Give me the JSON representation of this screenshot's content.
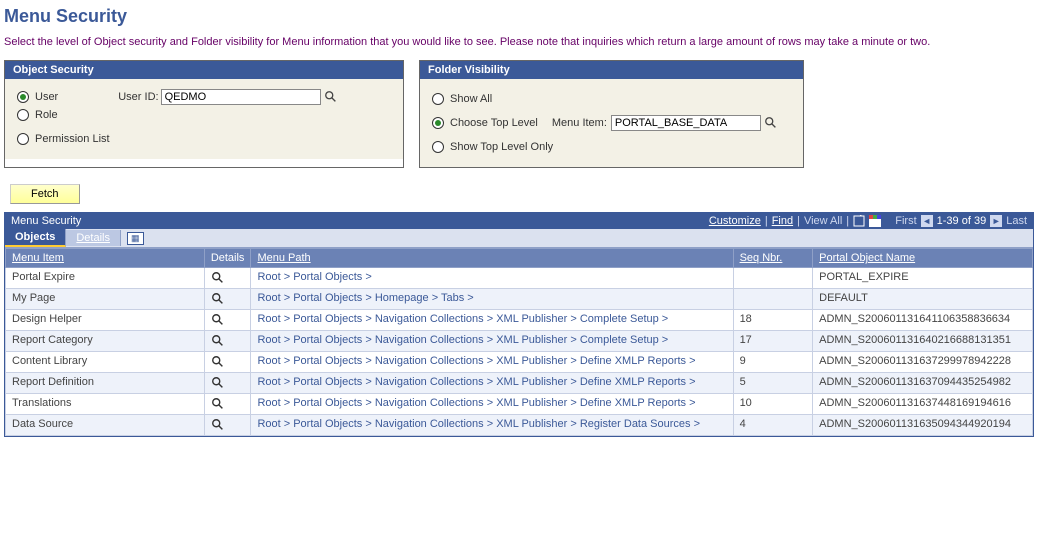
{
  "page": {
    "title": "Menu Security",
    "description": "Select the level of Object security and Folder visibility for Menu information that you would like to see. Please note that inquiries which return a large amount of rows may take a minute or two."
  },
  "object_security": {
    "header": "Object Security",
    "options": {
      "user": "User",
      "role": "Role",
      "perm": "Permission List"
    },
    "selected": "user",
    "user_id_label": "User ID:",
    "user_id_value": "QEDMO"
  },
  "folder_visibility": {
    "header": "Folder Visibility",
    "options": {
      "show_all": "Show All",
      "choose": "Choose Top Level",
      "top_only": "Show Top Level Only"
    },
    "selected": "choose",
    "menu_item_label": "Menu Item:",
    "menu_item_value": "PORTAL_BASE_DATA"
  },
  "fetch_label": "Fetch",
  "grid": {
    "title": "Menu Security",
    "toolbar": {
      "customize": "Customize",
      "find": "Find",
      "view_all": "View All",
      "first": "First",
      "range": "1-39 of 39",
      "last": "Last"
    },
    "tabs": {
      "objects": "Objects",
      "details": "Details"
    },
    "columns": {
      "menu_item": "Menu Item",
      "details": "Details",
      "menu_path": "Menu Path",
      "seq": "Seq Nbr.",
      "portal": "Portal Object Name"
    },
    "rows": [
      {
        "menu_item": "Portal Expire",
        "menu_path": "Root > Portal Objects >",
        "seq": "",
        "portal": "PORTAL_EXPIRE"
      },
      {
        "menu_item": "My Page",
        "menu_path": "Root > Portal Objects > Homepage > Tabs >",
        "seq": "",
        "portal": "DEFAULT"
      },
      {
        "menu_item": "Design Helper",
        "menu_path": "Root > Portal Objects > Navigation Collections > XML Publisher > Complete Setup >",
        "seq": "18",
        "portal": "ADMN_S200601131641106358836634"
      },
      {
        "menu_item": "Report Category",
        "menu_path": "Root > Portal Objects > Navigation Collections > XML Publisher > Complete Setup >",
        "seq": "17",
        "portal": "ADMN_S200601131640216688131351"
      },
      {
        "menu_item": "Content Library",
        "menu_path": "Root > Portal Objects > Navigation Collections > XML Publisher > Define XMLP Reports >",
        "seq": "9",
        "portal": "ADMN_S200601131637299978942228"
      },
      {
        "menu_item": "Report Definition",
        "menu_path": "Root > Portal Objects > Navigation Collections > XML Publisher > Define XMLP Reports >",
        "seq": "5",
        "portal": "ADMN_S200601131637094435254982"
      },
      {
        "menu_item": "Translations",
        "menu_path": "Root > Portal Objects > Navigation Collections > XML Publisher > Define XMLP Reports >",
        "seq": "10",
        "portal": "ADMN_S200601131637448169194616"
      },
      {
        "menu_item": "Data Source",
        "menu_path": "Root > Portal Objects > Navigation Collections > XML Publisher > Register Data Sources >",
        "seq": "4",
        "portal": "ADMN_S200601131635094344920194"
      }
    ]
  }
}
